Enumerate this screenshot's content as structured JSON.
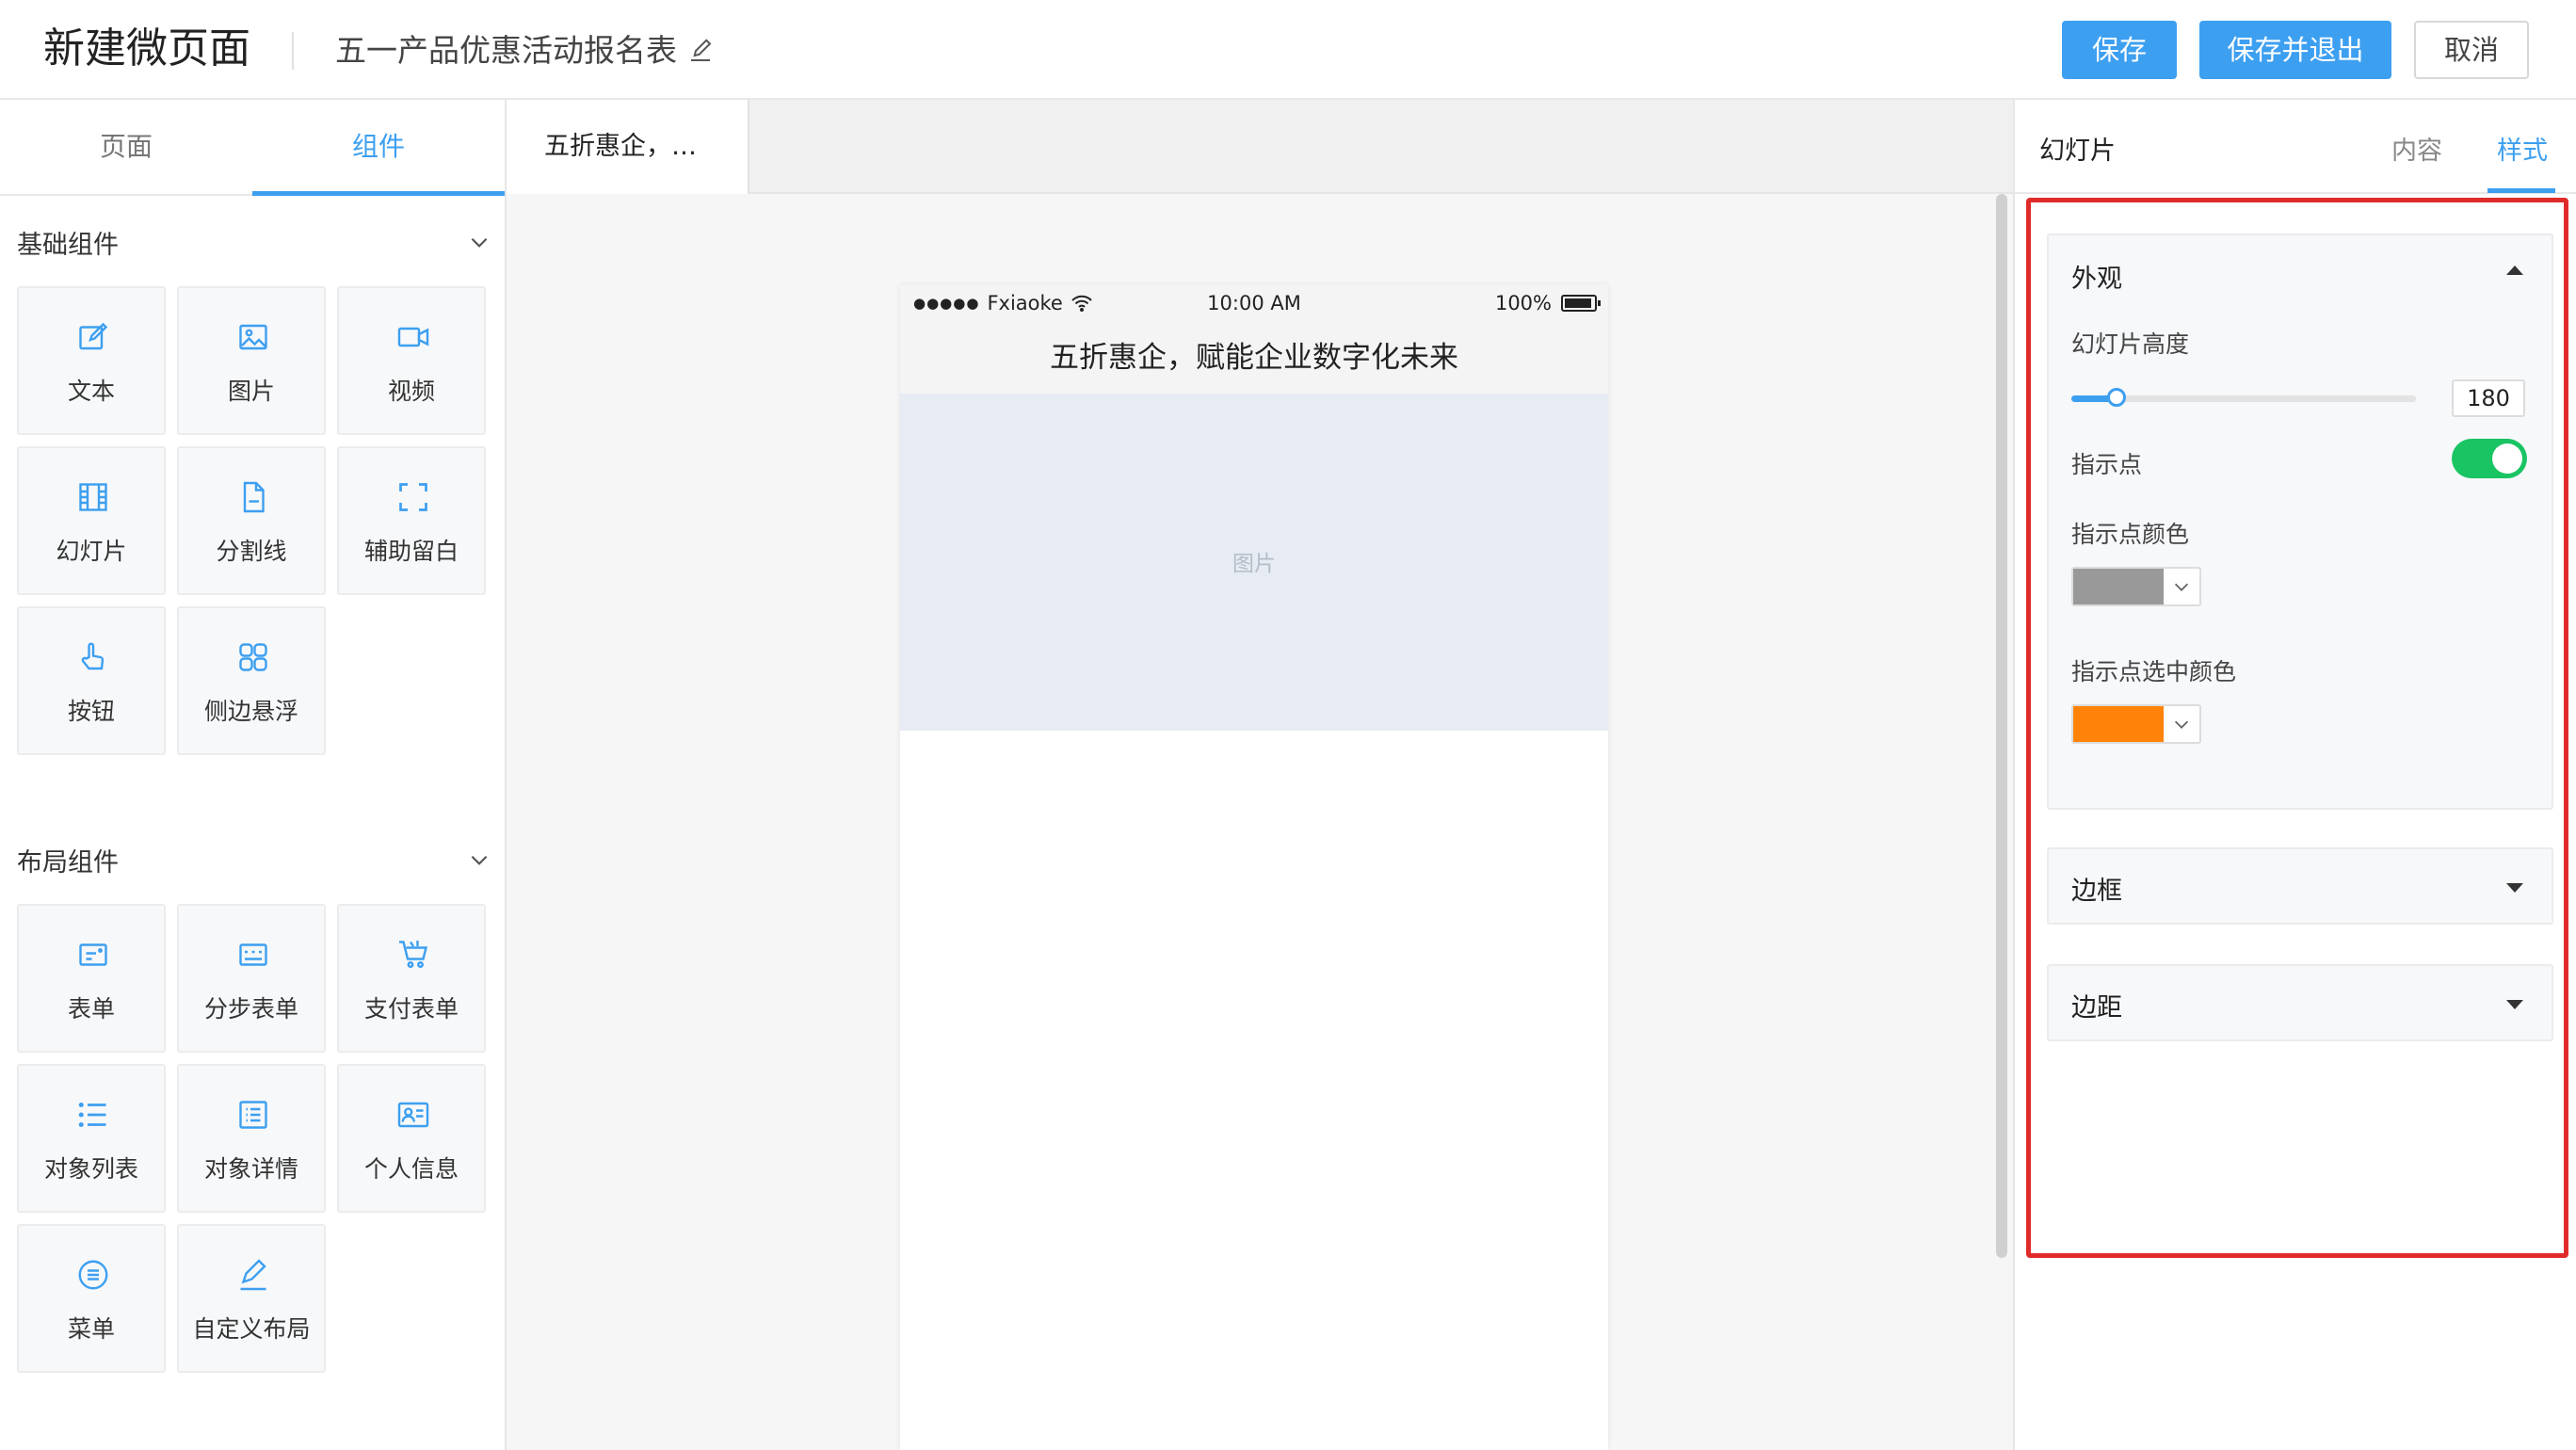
{
  "header": {
    "title": "新建微页面",
    "subtitle": "五一产品优惠活动报名表",
    "save_label": "保存",
    "save_exit_label": "保存并退出",
    "cancel_label": "取消"
  },
  "left": {
    "tabs": [
      "页面",
      "组件"
    ],
    "active_tab": "组件",
    "basic_title": "基础组件",
    "basic_items": [
      {
        "label": "文本",
        "icon": "edit-icon"
      },
      {
        "label": "图片",
        "icon": "image-icon"
      },
      {
        "label": "视频",
        "icon": "video-icon"
      },
      {
        "label": "幻灯片",
        "icon": "slides-icon"
      },
      {
        "label": "分割线",
        "icon": "divider-icon"
      },
      {
        "label": "辅助留白",
        "icon": "whitespace-icon"
      },
      {
        "label": "按钮",
        "icon": "tap-icon"
      },
      {
        "label": "侧边悬浮",
        "icon": "grid-icon"
      }
    ],
    "layout_title": "布局组件",
    "layout_items": [
      {
        "label": "表单",
        "icon": "form-icon"
      },
      {
        "label": "分步表单",
        "icon": "step-form-icon"
      },
      {
        "label": "支付表单",
        "icon": "cart-icon"
      },
      {
        "label": "对象列表",
        "icon": "list-icon"
      },
      {
        "label": "对象详情",
        "icon": "detail-icon"
      },
      {
        "label": "个人信息",
        "icon": "profile-card-icon"
      },
      {
        "label": "菜单",
        "icon": "menu-icon"
      },
      {
        "label": "自定义布局",
        "icon": "pen-icon"
      }
    ]
  },
  "canvas": {
    "page_tab": "五折惠企，…",
    "status": {
      "carrier": "Fxiaoke",
      "time": "10:00 AM",
      "battery": "100%"
    },
    "page_title": "五折惠企，赋能企业数字化未来",
    "image_placeholder": "图片"
  },
  "right": {
    "title": "幻灯片",
    "tabs": [
      "内容",
      "样式"
    ],
    "active_tab": "样式",
    "appearance": {
      "title": "外观",
      "height_label": "幻灯片高度",
      "height_value": "180",
      "height_fraction": 0.13,
      "dots_label": "指示点",
      "dots_enabled": true,
      "dot_color_label": "指示点颜色",
      "dot_color": "#999999",
      "active_dot_color_label": "指示点选中颜色",
      "active_dot_color": "#ff8309"
    },
    "border_title": "边框",
    "margin_title": "边距"
  },
  "colors": {
    "accent": "#3d9ff0",
    "toggle_on": "#19c463",
    "highlight": "#e02b2b"
  }
}
